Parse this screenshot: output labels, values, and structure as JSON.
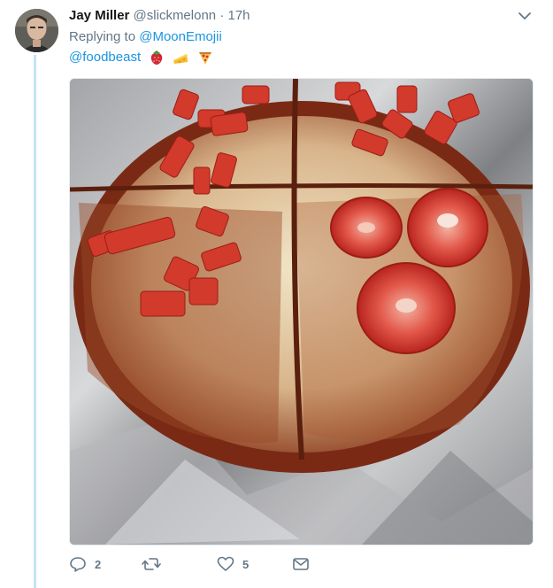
{
  "tweet": {
    "display_name": "Jay Miller",
    "handle": "@slickmelonn",
    "separator": "·",
    "time": "17h",
    "replying_prefix": "Replying to",
    "replying_to": "@MoonEmojii",
    "text_mention": "@foodbeast",
    "emojis": [
      "strawberry-icon",
      "cheese-icon",
      "pizza-icon"
    ]
  },
  "actions": {
    "reply_count": "2",
    "retweet_count": "",
    "like_count": "5"
  },
  "colors": {
    "link": "#1b95e0",
    "muted": "#657786",
    "thread_line": "#c4e4f6"
  }
}
